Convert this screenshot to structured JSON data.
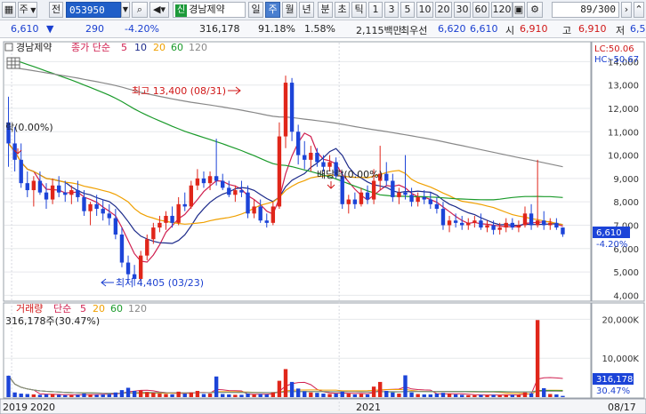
{
  "toolbar": {
    "mode": "주",
    "prev": "전",
    "code": "053950",
    "stock_tag": "신",
    "stock_name": "경남제약",
    "periods": [
      "일",
      "주",
      "월",
      "년",
      "분",
      "초",
      "틱"
    ],
    "active_period": "주",
    "intervals": [
      "1",
      "3",
      "5",
      "10",
      "20",
      "30",
      "60",
      "120"
    ],
    "count": "89/300"
  },
  "quote": {
    "price": "6,610",
    "change": "290",
    "change_pct": "-4.20%",
    "volume": "316,178",
    "vol_ratio": "91.18%",
    "turnover": "1.58%",
    "amount": "2,115백만",
    "best_ask_label": "최우선",
    "best_ask": "6,620",
    "best_bid": "6,610",
    "open_label": "시",
    "open": "6,910",
    "high_label": "고",
    "high": "6,910",
    "low_label": "저",
    "low": "6,5"
  },
  "price_panel": {
    "title": "경남제약",
    "ma_label": "종가 단순",
    "ma_periods": [
      "5",
      "10",
      "20",
      "60",
      "120"
    ],
    "lc": "LC:50.06",
    "hc": "HC:-50.67",
    "annotation_high": "최고 13,400 (08/31)",
    "annotation_low": "최저 4,405 (03/23)",
    "annotation_left": "락(0.00%)",
    "annotation_mid": "배당락(0.00%)",
    "current_price": "6,610",
    "current_pct": "-4.20%"
  },
  "volume_panel": {
    "title": "거래량",
    "ma_label": "단순",
    "ma_periods": [
      "5",
      "20",
      "60",
      "120"
    ],
    "current": "316,178주(30.47%)",
    "current_label": "316,178",
    "current_pct": "30.47%"
  },
  "x_axis": {
    "labels": [
      "2019",
      "2020",
      "2021"
    ],
    "right_label": "08/17"
  },
  "colors": {
    "up": "#e0261a",
    "down": "#1c44d8",
    "ma5": "#d02050",
    "ma10": "#1c2a8a",
    "ma20": "#f0a000",
    "ma60": "#1a9a2a",
    "ma120": "#888888"
  },
  "chart_data": {
    "type": "candlestick",
    "title": "경남제약",
    "price_axis_ticks": [
      4000,
      5000,
      6000,
      7000,
      8000,
      9000,
      10000,
      11000,
      12000,
      13000,
      14000
    ],
    "price_ylim": [
      3900,
      14700
    ],
    "volume_axis_ticks": [
      "10,000K",
      "20,000K"
    ],
    "volume_ylim": [
      0,
      21000
    ],
    "x_labels": [
      "2019",
      "2020",
      "2021"
    ],
    "candles": [
      {
        "o": 11400,
        "h": 12500,
        "l": 9500,
        "c": 10500,
        "v": 5500
      },
      {
        "o": 10500,
        "h": 11200,
        "l": 9300,
        "c": 9800,
        "v": 1200
      },
      {
        "o": 9800,
        "h": 10500,
        "l": 8600,
        "c": 8800,
        "v": 900
      },
      {
        "o": 8800,
        "h": 9300,
        "l": 8200,
        "c": 8500,
        "v": 800
      },
      {
        "o": 8500,
        "h": 9100,
        "l": 7800,
        "c": 8900,
        "v": 700
      },
      {
        "o": 8900,
        "h": 9300,
        "l": 8300,
        "c": 8400,
        "v": 600
      },
      {
        "o": 8400,
        "h": 8800,
        "l": 7700,
        "c": 8100,
        "v": 700
      },
      {
        "o": 8100,
        "h": 9000,
        "l": 7900,
        "c": 8700,
        "v": 800
      },
      {
        "o": 8700,
        "h": 9100,
        "l": 8200,
        "c": 8400,
        "v": 600
      },
      {
        "o": 8400,
        "h": 8900,
        "l": 8000,
        "c": 8300,
        "v": 500
      },
      {
        "o": 8300,
        "h": 8700,
        "l": 7900,
        "c": 8500,
        "v": 500
      },
      {
        "o": 8500,
        "h": 8900,
        "l": 8000,
        "c": 8200,
        "v": 600
      },
      {
        "o": 8200,
        "h": 8500,
        "l": 7400,
        "c": 7600,
        "v": 900
      },
      {
        "o": 7600,
        "h": 8000,
        "l": 7000,
        "c": 7900,
        "v": 700
      },
      {
        "o": 7900,
        "h": 8300,
        "l": 7400,
        "c": 7700,
        "v": 600
      },
      {
        "o": 7700,
        "h": 8100,
        "l": 7200,
        "c": 7500,
        "v": 700
      },
      {
        "o": 7500,
        "h": 7900,
        "l": 7000,
        "c": 7300,
        "v": 800
      },
      {
        "o": 7300,
        "h": 7700,
        "l": 6400,
        "c": 6600,
        "v": 1200
      },
      {
        "o": 6600,
        "h": 6900,
        "l": 5200,
        "c": 5400,
        "v": 1800
      },
      {
        "o": 5400,
        "h": 5700,
        "l": 4500,
        "c": 4900,
        "v": 2400
      },
      {
        "o": 4900,
        "h": 5300,
        "l": 4405,
        "c": 4700,
        "v": 1600
      },
      {
        "o": 4700,
        "h": 5900,
        "l": 4600,
        "c": 5700,
        "v": 1700
      },
      {
        "o": 5700,
        "h": 6600,
        "l": 5500,
        "c": 6400,
        "v": 1300
      },
      {
        "o": 6400,
        "h": 7100,
        "l": 6200,
        "c": 6900,
        "v": 1100
      },
      {
        "o": 6900,
        "h": 7400,
        "l": 6700,
        "c": 7100,
        "v": 900
      },
      {
        "o": 7100,
        "h": 7600,
        "l": 6800,
        "c": 7400,
        "v": 800
      },
      {
        "o": 7400,
        "h": 7800,
        "l": 6900,
        "c": 7100,
        "v": 700
      },
      {
        "o": 7100,
        "h": 8200,
        "l": 7000,
        "c": 7900,
        "v": 1400
      },
      {
        "o": 7900,
        "h": 8400,
        "l": 7600,
        "c": 7800,
        "v": 900
      },
      {
        "o": 7800,
        "h": 8900,
        "l": 7700,
        "c": 8700,
        "v": 1200
      },
      {
        "o": 8700,
        "h": 9400,
        "l": 8500,
        "c": 9000,
        "v": 1600
      },
      {
        "o": 9000,
        "h": 9300,
        "l": 8600,
        "c": 8800,
        "v": 800
      },
      {
        "o": 8800,
        "h": 9300,
        "l": 8500,
        "c": 9100,
        "v": 900
      },
      {
        "o": 9100,
        "h": 10700,
        "l": 8700,
        "c": 8900,
        "v": 5300
      },
      {
        "o": 8900,
        "h": 9200,
        "l": 8500,
        "c": 8600,
        "v": 800
      },
      {
        "o": 8600,
        "h": 8900,
        "l": 8200,
        "c": 8300,
        "v": 700
      },
      {
        "o": 8300,
        "h": 8700,
        "l": 8000,
        "c": 8500,
        "v": 600
      },
      {
        "o": 8500,
        "h": 8900,
        "l": 8200,
        "c": 8400,
        "v": 600
      },
      {
        "o": 8400,
        "h": 8700,
        "l": 7300,
        "c": 7500,
        "v": 900
      },
      {
        "o": 7500,
        "h": 8100,
        "l": 7300,
        "c": 7800,
        "v": 700
      },
      {
        "o": 7800,
        "h": 8100,
        "l": 7100,
        "c": 7200,
        "v": 800
      },
      {
        "o": 7200,
        "h": 7500,
        "l": 6900,
        "c": 7100,
        "v": 700
      },
      {
        "o": 7100,
        "h": 8000,
        "l": 7000,
        "c": 7800,
        "v": 1200
      },
      {
        "o": 7800,
        "h": 11400,
        "l": 7700,
        "c": 10800,
        "v": 4200
      },
      {
        "o": 10800,
        "h": 13400,
        "l": 10300,
        "c": 13100,
        "v": 7200
      },
      {
        "o": 13100,
        "h": 13300,
        "l": 10600,
        "c": 11000,
        "v": 3900
      },
      {
        "o": 11000,
        "h": 11300,
        "l": 9600,
        "c": 10000,
        "v": 2200
      },
      {
        "o": 10000,
        "h": 10600,
        "l": 9400,
        "c": 9800,
        "v": 1500
      },
      {
        "o": 9800,
        "h": 10400,
        "l": 9300,
        "c": 10100,
        "v": 1200
      },
      {
        "o": 10100,
        "h": 10300,
        "l": 9500,
        "c": 9700,
        "v": 1100
      },
      {
        "o": 9700,
        "h": 10000,
        "l": 9300,
        "c": 9500,
        "v": 900
      },
      {
        "o": 9500,
        "h": 10000,
        "l": 9300,
        "c": 9700,
        "v": 800
      },
      {
        "o": 9700,
        "h": 9900,
        "l": 9000,
        "c": 9100,
        "v": 900
      },
      {
        "o": 9100,
        "h": 9300,
        "l": 7700,
        "c": 7900,
        "v": 1400
      },
      {
        "o": 7900,
        "h": 8300,
        "l": 7500,
        "c": 8100,
        "v": 900
      },
      {
        "o": 8100,
        "h": 8400,
        "l": 7700,
        "c": 7900,
        "v": 700
      },
      {
        "o": 7900,
        "h": 8600,
        "l": 7800,
        "c": 8400,
        "v": 800
      },
      {
        "o": 8400,
        "h": 8700,
        "l": 7900,
        "c": 8100,
        "v": 700
      },
      {
        "o": 8100,
        "h": 9400,
        "l": 7900,
        "c": 8900,
        "v": 2700
      },
      {
        "o": 8900,
        "h": 10400,
        "l": 8500,
        "c": 9200,
        "v": 3900
      },
      {
        "o": 9200,
        "h": 9700,
        "l": 8700,
        "c": 8900,
        "v": 1600
      },
      {
        "o": 8900,
        "h": 9200,
        "l": 8000,
        "c": 8200,
        "v": 1200
      },
      {
        "o": 8200,
        "h": 8600,
        "l": 7900,
        "c": 8400,
        "v": 900
      },
      {
        "o": 8400,
        "h": 10000,
        "l": 8100,
        "c": 8300,
        "v": 5600
      },
      {
        "o": 8300,
        "h": 8600,
        "l": 7800,
        "c": 8000,
        "v": 1200
      },
      {
        "o": 8000,
        "h": 8400,
        "l": 7800,
        "c": 8200,
        "v": 800
      },
      {
        "o": 8200,
        "h": 8500,
        "l": 7900,
        "c": 8100,
        "v": 700
      },
      {
        "o": 8100,
        "h": 8400,
        "l": 7700,
        "c": 7900,
        "v": 700
      },
      {
        "o": 7900,
        "h": 8200,
        "l": 7500,
        "c": 7700,
        "v": 900
      },
      {
        "o": 7700,
        "h": 8000,
        "l": 6800,
        "c": 7000,
        "v": 1100
      },
      {
        "o": 7000,
        "h": 7400,
        "l": 6700,
        "c": 7200,
        "v": 900
      },
      {
        "o": 7200,
        "h": 7500,
        "l": 6900,
        "c": 7100,
        "v": 700
      },
      {
        "o": 7100,
        "h": 7400,
        "l": 6800,
        "c": 7000,
        "v": 600
      },
      {
        "o": 7000,
        "h": 7300,
        "l": 6800,
        "c": 7100,
        "v": 500
      },
      {
        "o": 7100,
        "h": 7400,
        "l": 6900,
        "c": 7200,
        "v": 500
      },
      {
        "o": 7200,
        "h": 7500,
        "l": 6800,
        "c": 6900,
        "v": 600
      },
      {
        "o": 6900,
        "h": 7200,
        "l": 6700,
        "c": 7000,
        "v": 500
      },
      {
        "o": 7000,
        "h": 7200,
        "l": 6600,
        "c": 6800,
        "v": 600
      },
      {
        "o": 6800,
        "h": 7100,
        "l": 6600,
        "c": 6900,
        "v": 500
      },
      {
        "o": 6900,
        "h": 7300,
        "l": 6700,
        "c": 7100,
        "v": 700
      },
      {
        "o": 7100,
        "h": 7300,
        "l": 6800,
        "c": 6900,
        "v": 600
      },
      {
        "o": 6900,
        "h": 7200,
        "l": 6700,
        "c": 7000,
        "v": 600
      },
      {
        "o": 7000,
        "h": 7800,
        "l": 6900,
        "c": 7500,
        "v": 1200
      },
      {
        "o": 7500,
        "h": 7900,
        "l": 6800,
        "c": 7000,
        "v": 1000
      },
      {
        "o": 7000,
        "h": 9800,
        "l": 6900,
        "c": 7200,
        "v": 19800
      },
      {
        "o": 7200,
        "h": 7600,
        "l": 6800,
        "c": 7000,
        "v": 2300
      },
      {
        "o": 7000,
        "h": 7300,
        "l": 6800,
        "c": 7100,
        "v": 800
      },
      {
        "o": 7100,
        "h": 7300,
        "l": 6800,
        "c": 6900,
        "v": 700
      },
      {
        "o": 6900,
        "h": 6910,
        "l": 6500,
        "c": 6610,
        "v": 316
      }
    ]
  }
}
